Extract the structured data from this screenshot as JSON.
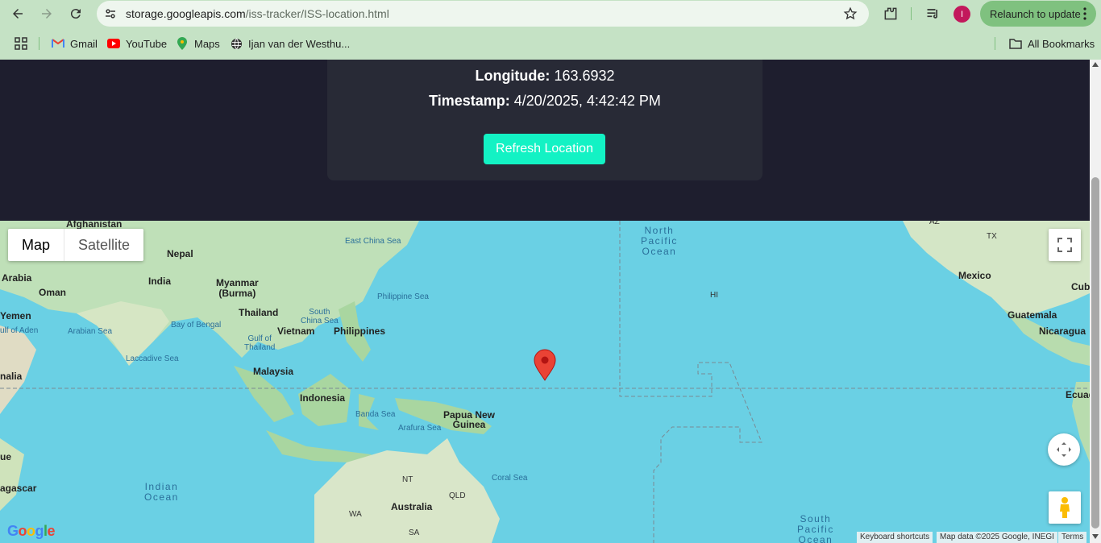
{
  "browser": {
    "url_host": "storage.googleapis.com",
    "url_path": "/iss-tracker/ISS-location.html",
    "avatar_letter": "I",
    "relaunch_label": "Relaunch to update",
    "bookmarks": [
      {
        "label": "Gmail",
        "icon": "gmail-icon"
      },
      {
        "label": "YouTube",
        "icon": "youtube-icon"
      },
      {
        "label": "Maps",
        "icon": "maps-icon"
      },
      {
        "label": "Ijan van der Westhu...",
        "icon": "globe-icon"
      }
    ],
    "all_bookmarks_label": "All Bookmarks"
  },
  "card": {
    "longitude_label": "Longitude:",
    "longitude_value": "163.6932",
    "timestamp_label": "Timestamp:",
    "timestamp_value": "4/20/2025, 4:42:42 PM",
    "refresh_label": "Refresh Location"
  },
  "map": {
    "type_map": "Map",
    "type_satellite": "Satellite",
    "attribution": {
      "shortcuts": "Keyboard shortcuts",
      "data": "Map data ©2025 Google, INEGI",
      "terms": "Terms"
    },
    "logo": "Google",
    "labels": {
      "afghanistan": "Afghanistan",
      "nepal": "Nepal",
      "arabia": "Arabia",
      "oman": "Oman",
      "india": "India",
      "myanmar": "Myanmar\n(Burma)",
      "thailand": "Thailand",
      "vietnam": "Vietnam",
      "philippines": "Philippines",
      "yemen": "Yemen",
      "gulf_aden": "ulf of Aden",
      "arabian_sea": "Arabian Sea",
      "bay_bengal": "Bay of Bengal",
      "laccadive": "Laccadive Sea",
      "malaysia": "Malaysia",
      "indonesia": "Indonesia",
      "somalia": "nalia",
      "east_china_sea": "East China Sea",
      "philippine_sea": "Philippine Sea",
      "south_china_sea": "South\nChina Sea",
      "gulf_thailand": "Gulf of\nThailand",
      "banda_sea": "Banda Sea",
      "arafura_sea": "Arafura Sea",
      "png": "Papua New\nGuinea",
      "coral_sea": "Coral Sea",
      "australia": "Australia",
      "nt": "NT",
      "qld": "QLD",
      "wa": "WA",
      "sa": "SA",
      "indian_ocean": "Indian\nOcean",
      "madagascar": "agascar",
      "mozambique": "ue",
      "north_pacific": "North\nPacific\nOcean",
      "south_pacific": "South\nPacific\nOcean",
      "hi": "HI",
      "mexico": "Mexico",
      "cuba": "Cub",
      "guatemala": "Guatemala",
      "nicaragua": "Nicaragua",
      "ecuador": "Ecuad",
      "tx": "TX",
      "az": "AZ"
    }
  }
}
